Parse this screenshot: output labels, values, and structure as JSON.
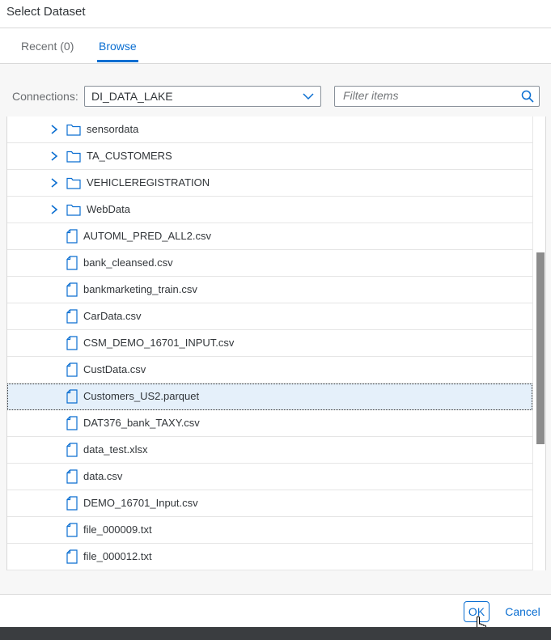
{
  "dialog": {
    "title": "Select Dataset"
  },
  "tabs": {
    "recent": "Recent (0)",
    "browse": "Browse"
  },
  "connections": {
    "label": "Connections:",
    "value": "DI_DATA_LAKE"
  },
  "filter": {
    "placeholder": "Filter items",
    "value": ""
  },
  "items": [
    {
      "type": "folder",
      "name": "sensordata"
    },
    {
      "type": "folder",
      "name": "TA_CUSTOMERS"
    },
    {
      "type": "folder",
      "name": "VEHICLEREGISTRATION"
    },
    {
      "type": "folder",
      "name": "WebData"
    },
    {
      "type": "file",
      "name": "AUTOML_PRED_ALL2.csv"
    },
    {
      "type": "file",
      "name": "bank_cleansed.csv"
    },
    {
      "type": "file",
      "name": "bankmarketing_train.csv"
    },
    {
      "type": "file",
      "name": "CarData.csv"
    },
    {
      "type": "file",
      "name": "CSM_DEMO_16701_INPUT.csv"
    },
    {
      "type": "file",
      "name": "CustData.csv"
    },
    {
      "type": "file",
      "name": "Customers_US2.parquet",
      "selected": true
    },
    {
      "type": "file",
      "name": "DAT376_bank_TAXY.csv"
    },
    {
      "type": "file",
      "name": "data_test.xlsx"
    },
    {
      "type": "file",
      "name": "data.csv"
    },
    {
      "type": "file",
      "name": "DEMO_16701_Input.csv"
    },
    {
      "type": "file",
      "name": "file_000009.txt"
    },
    {
      "type": "file",
      "name": "file_000012.txt"
    }
  ],
  "buttons": {
    "ok": "OK",
    "cancel": "Cancel"
  },
  "colors": {
    "accent": "#0a6ed1",
    "selected_row": "#e5f0fa",
    "text": "#32363a"
  }
}
